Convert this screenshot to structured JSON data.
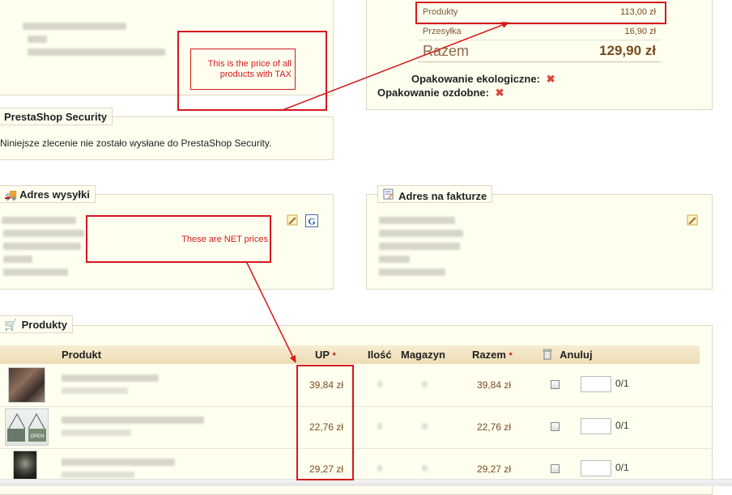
{
  "summary": {
    "products_label": "Produkty",
    "products_value": "113,00 zł",
    "shipping_label": "Przesyłka",
    "shipping_value": "16,90 zł",
    "total_label": "Razem",
    "total_value": "129,90 zł"
  },
  "packaging": {
    "eco_label": "Opakowanie ekologiczne:",
    "gift_label": "Opakowanie ozdobne:"
  },
  "annotations": {
    "tax_note": "This is the price of all products with TAX",
    "net_note": "These are NET prices"
  },
  "security": {
    "title": "PrestaShop Security",
    "message": "Niniejsze zlecenie nie zostało wysłane do PrestaShop Security."
  },
  "shipping_address": {
    "title": "Adres wysyłki"
  },
  "invoice_address": {
    "title": "Adres na fakturze"
  },
  "products": {
    "title": "Produkty",
    "columns": {
      "product": "Produkt",
      "unit_price": "UP",
      "unit_price_asterisk": "*",
      "quantity": "Ilość",
      "stock": "Magazyn",
      "total": "Razem",
      "total_asterisk": "*",
      "cancel": "Anuluj"
    },
    "rows": [
      {
        "unit_price": "39,84 zł",
        "total": "39,84 zł",
        "cancel_ratio": "0/1"
      },
      {
        "unit_price": "22,76 zł",
        "total": "22,76 zł",
        "cancel_ratio": "0/1"
      },
      {
        "unit_price": "29,27 zł",
        "total": "29,27 zł",
        "cancel_ratio": "0/1"
      }
    ]
  },
  "colors": {
    "annotation_red": "#d4181b",
    "panel_bg": "#fffff0",
    "table_header_bg": "#f2e6c6",
    "price_brown": "#7a4a1f"
  }
}
